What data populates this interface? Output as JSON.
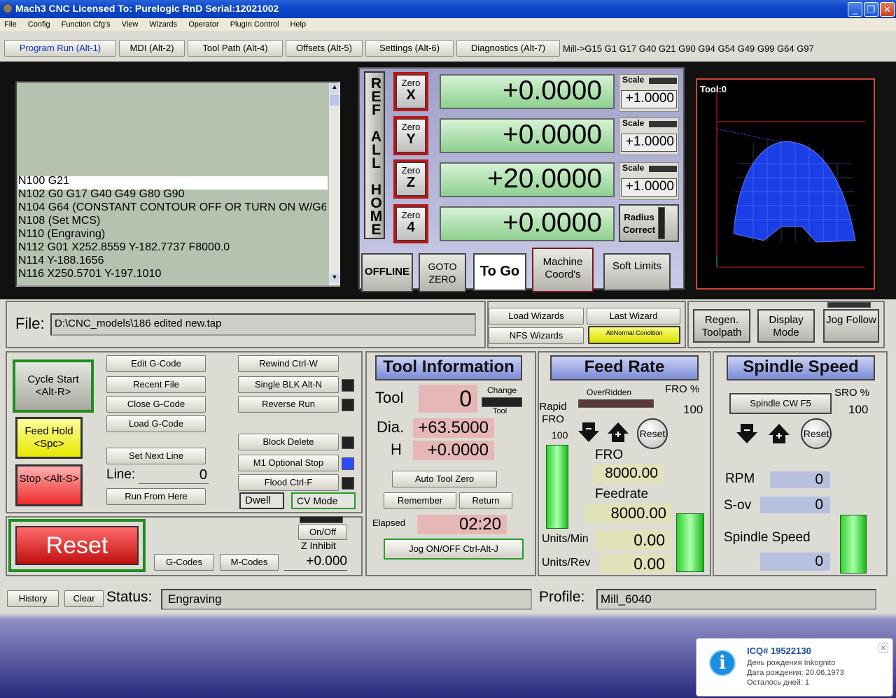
{
  "window": {
    "title": "Mach3 CNC  Licensed To: Purelogic RnD Serial:12021002",
    "minimize": "_",
    "maximize": "❐",
    "close": "✕"
  },
  "menu": [
    "File",
    "Config",
    "Function Cfg's",
    "View",
    "Wizards",
    "Operator",
    "PlugIn Control",
    "Help"
  ],
  "tabs": [
    "Program Run (Alt-1)",
    "MDI (Alt-2)",
    "Tool Path (Alt-4)",
    "Offsets (Alt-5)",
    "Settings (Alt-6)",
    "Diagnostics (Alt-7)"
  ],
  "modal_line": "Mill->G15  G1 G17 G40 G21 G90 G94 G54 G49 G99 G64 G97",
  "gcode_lines": [
    "N100 G21",
    "N102 G0 G17 G40 G49 G80 G90",
    "N104 G64 (CONSTANT CONTOUR OFF OR TURN ON W/G6",
    "N108 (Set MCS)",
    "N110 (Engraving)",
    "N112 G01 X252.8559 Y-182.7737 F8000.0",
    "N114 Y-188.1656",
    "N116 X250.5701 Y-197.1010"
  ],
  "ref_all_home": "REF ALL HOME",
  "axes": [
    {
      "zero_label": "Zero",
      "axis": "X",
      "dro": "+0.0000",
      "scale_label": "Scale",
      "scale": "+1.0000"
    },
    {
      "zero_label": "Zero",
      "axis": "Y",
      "dro": "+0.0000",
      "scale_label": "Scale",
      "scale": "+1.0000"
    },
    {
      "zero_label": "Zero",
      "axis": "Z",
      "dro": "+20.0000",
      "scale_label": "Scale",
      "scale": "+1.0000"
    },
    {
      "zero_label": "Zero",
      "axis": "4",
      "dro": "+0.0000",
      "scale_label": "",
      "scale": ""
    }
  ],
  "radius_correct": "Radius Correct",
  "dro_buttons": {
    "offline": "OFFLINE",
    "goto_zero": "GOTO ZERO",
    "to_go": "To Go",
    "machine_coords": "Machine Coord's",
    "soft_limits": "Soft Limits"
  },
  "toolpath": {
    "tool_label": "Tool:0"
  },
  "file": {
    "label": "File:",
    "path": "D:\\CNC_models\\186 edited new.tap"
  },
  "wizards": {
    "load": "Load Wizards",
    "last": "Last Wizard",
    "nfs": "NFS Wizards",
    "abnormal": "AbNormal Condition"
  },
  "view_buttons": {
    "regen": "Regen. Toolpath",
    "display_mode": "Display Mode",
    "jog_follow": "Jog Follow"
  },
  "program": {
    "cycle_start": "Cycle Start <Alt-R>",
    "feed_hold": "Feed Hold <Spc>",
    "stop": "Stop <Alt-S>",
    "edit": "Edit G-Code",
    "recent": "Recent File",
    "close": "Close G-Code",
    "load": "Load G-Code",
    "set_next": "Set Next Line",
    "line_label": "Line:",
    "line_value": "0",
    "run_from_here": "Run From Here",
    "rewind": "Rewind Ctrl-W",
    "single_blk": "Single BLK Alt-N",
    "reverse_run": "Reverse Run",
    "block_delete": "Block Delete",
    "m1_optional": "M1 Optional Stop",
    "flood": "Flood Ctrl-F",
    "dwell": "Dwell",
    "cv_mode": "CV Mode"
  },
  "reset": {
    "label": "Reset",
    "gcodes": "G-Codes",
    "mcodes": "M-Codes",
    "onoff": "On/Off",
    "z_inhibit": "Z Inhibit",
    "z_value": "+0.000"
  },
  "tool_info": {
    "title": "Tool Information",
    "tool_label": "Tool",
    "tool_value": "0",
    "change": "Change",
    "change_tool": "Tool",
    "dia_label": "Dia.",
    "dia_value": "+63.5000",
    "h_label": "H",
    "h_value": "+0.0000",
    "auto_zero": "Auto Tool Zero",
    "remember": "Remember",
    "return": "Return",
    "elapsed_label": "Elapsed",
    "elapsed_value": "02:20",
    "jog": "Jog ON/OFF Ctrl-Alt-J"
  },
  "feed": {
    "title": "Feed Rate",
    "overridden": "OverRidden",
    "fro_pct_label": "FRO %",
    "fro_pct": "100",
    "rapid_label": "Rapid FRO",
    "rapid_value": "100",
    "reset": "Reset",
    "fro_label": "FRO",
    "fro_value": "8000.00",
    "feedrate_label": "Feedrate",
    "feedrate_value": "8000.00",
    "units_min_label": "Units/Min",
    "units_min": "0.00",
    "units_rev_label": "Units/Rev",
    "units_rev": "0.00"
  },
  "spindle": {
    "title": "Spindle Speed",
    "cw": "Spindle CW F5",
    "sro_label": "SRO %",
    "sro_value": "100",
    "reset": "Reset",
    "rpm_label": "RPM",
    "rpm": "0",
    "sov_label": "S-ov",
    "sov": "0",
    "speed_label": "Spindle Speed",
    "speed": "0"
  },
  "status": {
    "history": "History",
    "clear": "Clear",
    "label": "Status:",
    "value": "Engraving",
    "profile_label": "Profile:",
    "profile": "Mill_6040"
  },
  "icq": {
    "title": "ICQ# 19522130",
    "line1": "День рождения Inkognito",
    "line2": "Дата рождения: 20.06.1973",
    "line3": "Осталось дней: 1",
    "close": "✕"
  }
}
